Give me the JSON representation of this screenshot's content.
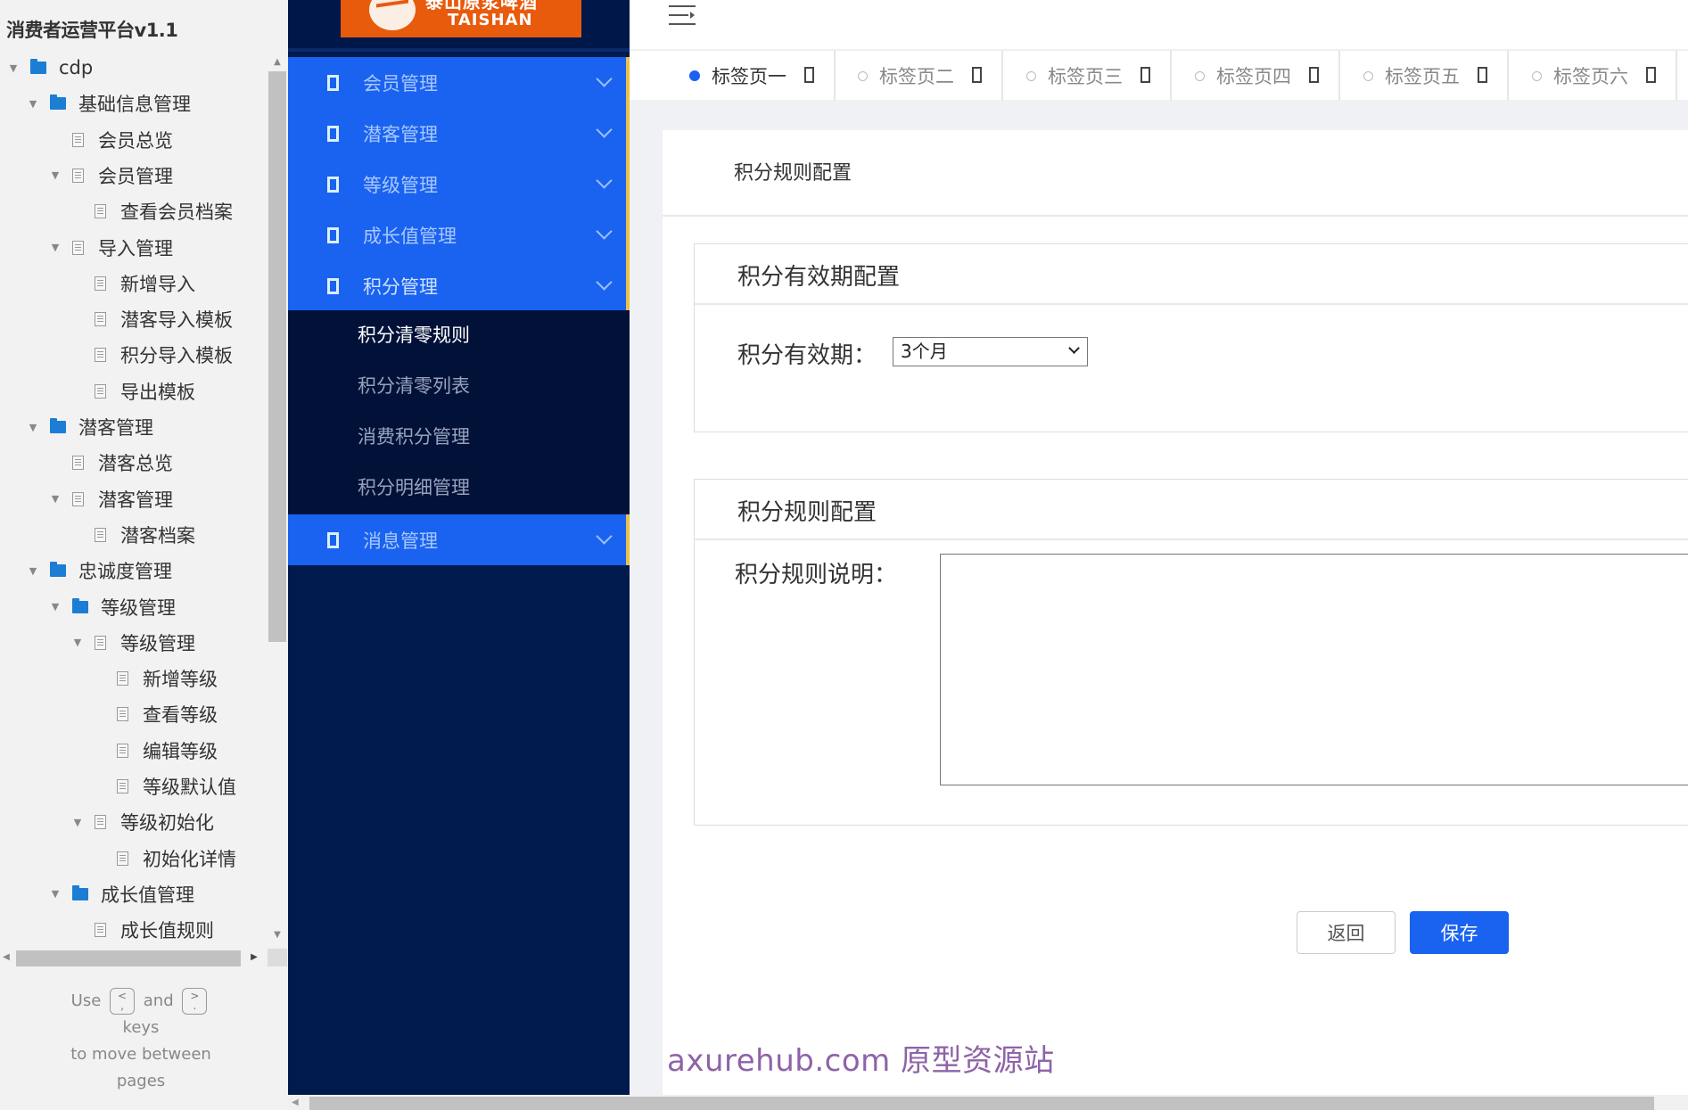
{
  "sitemap": {
    "title": "消费者运营平台v1.1",
    "items": [
      {
        "label": "cdp",
        "type": "folder",
        "depth": 0,
        "expanded": true
      },
      {
        "label": "基础信息管理",
        "type": "folder",
        "depth": 1,
        "expanded": true
      },
      {
        "label": "会员总览",
        "type": "page",
        "depth": 2,
        "expanded": false
      },
      {
        "label": "会员管理",
        "type": "page",
        "depth": 2,
        "expanded": true
      },
      {
        "label": "查看会员档案",
        "type": "page",
        "depth": 3,
        "expanded": false
      },
      {
        "label": "导入管理",
        "type": "page",
        "depth": 2,
        "expanded": true
      },
      {
        "label": "新增导入",
        "type": "page",
        "depth": 3,
        "expanded": false
      },
      {
        "label": "潜客导入模板",
        "type": "page",
        "depth": 3,
        "expanded": false
      },
      {
        "label": "积分导入模板",
        "type": "page",
        "depth": 3,
        "expanded": false
      },
      {
        "label": "导出模板",
        "type": "page",
        "depth": 3,
        "expanded": false
      },
      {
        "label": "潜客管理",
        "type": "folder",
        "depth": 1,
        "expanded": true
      },
      {
        "label": "潜客总览",
        "type": "page",
        "depth": 2,
        "expanded": false
      },
      {
        "label": "潜客管理",
        "type": "page",
        "depth": 2,
        "expanded": true
      },
      {
        "label": "潜客档案",
        "type": "page",
        "depth": 3,
        "expanded": false
      },
      {
        "label": "忠诚度管理",
        "type": "folder",
        "depth": 1,
        "expanded": true
      },
      {
        "label": "等级管理",
        "type": "folder",
        "depth": 2,
        "expanded": true
      },
      {
        "label": "等级管理",
        "type": "page",
        "depth": 3,
        "expanded": true
      },
      {
        "label": "新增等级",
        "type": "page",
        "depth": 4,
        "expanded": false
      },
      {
        "label": "查看等级",
        "type": "page",
        "depth": 4,
        "expanded": false
      },
      {
        "label": "编辑等级",
        "type": "page",
        "depth": 4,
        "expanded": false
      },
      {
        "label": "等级默认值",
        "type": "page",
        "depth": 4,
        "expanded": false
      },
      {
        "label": "等级初始化",
        "type": "page",
        "depth": 3,
        "expanded": true
      },
      {
        "label": "初始化详情",
        "type": "page",
        "depth": 4,
        "expanded": false
      },
      {
        "label": "成长值管理",
        "type": "folder",
        "depth": 2,
        "expanded": true
      },
      {
        "label": "成长值规则",
        "type": "page",
        "depth": 3,
        "expanded": false
      }
    ],
    "hint": {
      "use": "Use",
      "key_prev_top": "<",
      "key_prev_bottom": ",",
      "and": "and",
      "key_next_top": ">",
      "key_next_bottom": ".",
      "keys": "keys",
      "line2": "to move between",
      "line3": "pages"
    }
  },
  "nav": {
    "logo": {
      "cn": "泰山原浆啤酒",
      "en": "TAISHAN"
    },
    "items": [
      {
        "label": "会员管理",
        "icon": "square-icon",
        "expanded": false
      },
      {
        "label": "潜客管理",
        "icon": "square-icon",
        "expanded": false
      },
      {
        "label": "等级管理",
        "icon": "square-icon",
        "expanded": false
      },
      {
        "label": "成长值管理",
        "icon": "square-icon",
        "expanded": false
      },
      {
        "label": "积分管理",
        "icon": "square-icon",
        "expanded": true
      },
      {
        "label": "消息管理",
        "icon": "square-icon",
        "expanded": false
      }
    ],
    "submenu": [
      {
        "label": "积分清零规则",
        "active": true
      },
      {
        "label": "积分清零列表",
        "active": false
      },
      {
        "label": "消费积分管理",
        "active": false
      },
      {
        "label": "积分明细管理",
        "active": false
      }
    ]
  },
  "tabs": [
    {
      "label": "标签页一",
      "active": true
    },
    {
      "label": "标签页二",
      "active": false
    },
    {
      "label": "标签页三",
      "active": false
    },
    {
      "label": "标签页四",
      "active": false
    },
    {
      "label": "标签页五",
      "active": false
    },
    {
      "label": "标签页六",
      "active": false
    }
  ],
  "page": {
    "title": "积分规则配置",
    "validity_section": {
      "title": "积分有效期配置",
      "label": "积分有效期：",
      "selected": "3个月"
    },
    "rule_section": {
      "title": "积分规则配置",
      "label": "积分规则说明：",
      "value": ""
    },
    "buttons": {
      "back": "返回",
      "save": "保存"
    },
    "watermark": "axurehub.com 原型资源站"
  },
  "colors": {
    "primary": "#1a62f0",
    "nav_bg": "#001a4e",
    "logo_bg": "#e85a0c",
    "accent_edge": "#e8c04a",
    "watermark": "#8e63a8"
  }
}
